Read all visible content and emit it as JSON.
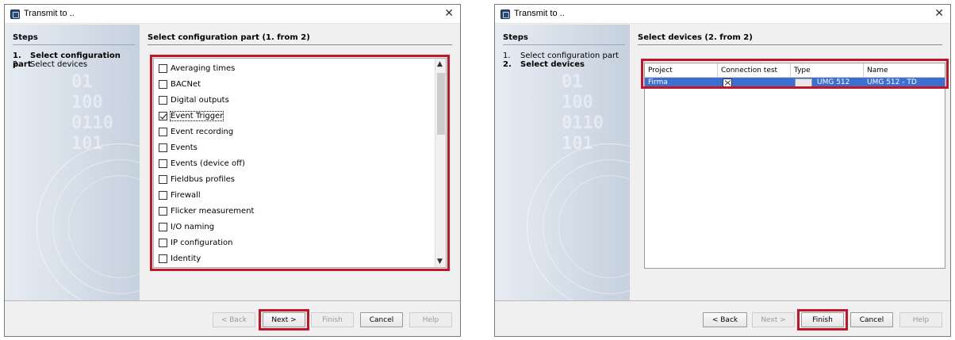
{
  "dialog1": {
    "title": "Transmit to ..",
    "steps_heading": "Steps",
    "steps": [
      {
        "num": "1.",
        "label": "Select configuration part"
      },
      {
        "num": "2.",
        "label": "Select devices"
      }
    ],
    "watermark": "01\n100\n0110\n101",
    "content_heading": "Select configuration part (1. from 2)",
    "items": [
      {
        "label": "Averaging times",
        "checked": false
      },
      {
        "label": "BACNet",
        "checked": false
      },
      {
        "label": "Digital outputs",
        "checked": false
      },
      {
        "label": "Event Trigger",
        "checked": true
      },
      {
        "label": "Event recording",
        "checked": false
      },
      {
        "label": "Events",
        "checked": false
      },
      {
        "label": "Events (device off)",
        "checked": false
      },
      {
        "label": "Fieldbus profiles",
        "checked": false
      },
      {
        "label": "Firewall",
        "checked": false
      },
      {
        "label": "Flicker measurement",
        "checked": false
      },
      {
        "label": "I/O naming",
        "checked": false
      },
      {
        "label": "IP configuration",
        "checked": false
      },
      {
        "label": "Identity",
        "checked": false
      }
    ],
    "buttons": {
      "back": "< Back",
      "next": "Next >",
      "finish": "Finish",
      "cancel": "Cancel",
      "help": "Help"
    }
  },
  "dialog2": {
    "title": "Transmit to ..",
    "steps_heading": "Steps",
    "steps": [
      {
        "num": "1.",
        "label": "Select configuration part"
      },
      {
        "num": "2.",
        "label": "Select devices"
      }
    ],
    "watermark": "01\n100\n0110\n101",
    "content_heading": "Select devices (2. from 2)",
    "columns": [
      "Project",
      "Connection test",
      "Type",
      "Name"
    ],
    "rows": [
      {
        "project": "Firma",
        "type": "UMG 512",
        "name": "UMG 512 - TD"
      }
    ],
    "buttons": {
      "back": "< Back",
      "next": "Next >",
      "finish": "Finish",
      "cancel": "Cancel",
      "help": "Help"
    }
  },
  "colors": {
    "highlight_box": "#c0182a",
    "selection": "#3c6fd0"
  }
}
